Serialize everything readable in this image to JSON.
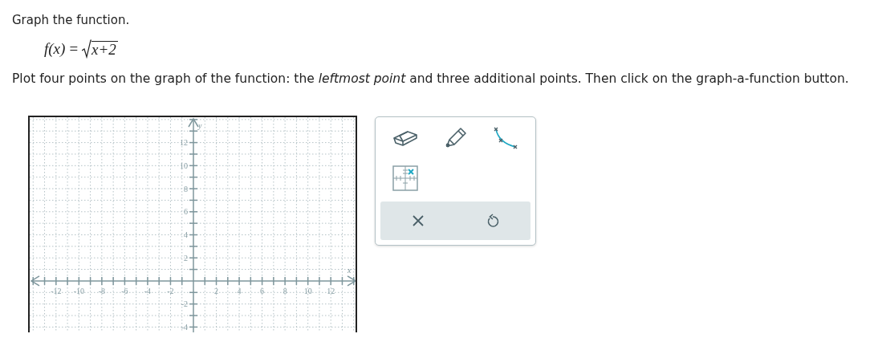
{
  "heading": "Graph the function.",
  "formula": {
    "lhs": "f(x)",
    "relation": "=",
    "radicand": "x+2"
  },
  "instruction": "Plot four points on the graph of the function: the *leftmost point* and three additional points. Then click on the graph-a-function button.",
  "graph": {
    "chart_data": {
      "type": "scatter",
      "grid": true,
      "xlabel": "x",
      "ylabel": "y",
      "xlim": [
        -14.3,
        14.3
      ],
      "ylim": [
        -4.6,
        14.2
      ],
      "xticks": [
        -12,
        -10,
        -8,
        -6,
        -4,
        -2,
        2,
        4,
        6,
        8,
        10,
        12
      ],
      "yticks": [
        -4,
        -2,
        2,
        4,
        6,
        8,
        10,
        12
      ]
    }
  },
  "tools": [
    {
      "kind": "eraser"
    },
    {
      "kind": "pencil"
    },
    {
      "kind": "curve"
    },
    {
      "kind": "point"
    }
  ],
  "actions": [
    {
      "kind": "clear"
    },
    {
      "kind": "undo"
    }
  ]
}
